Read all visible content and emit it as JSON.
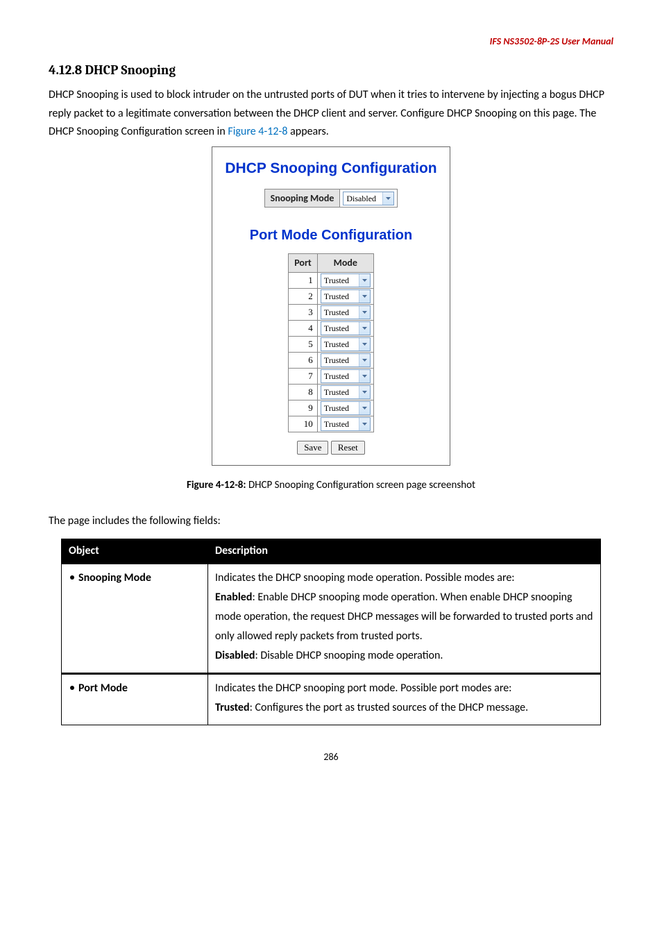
{
  "header": {
    "product_line": "IFS NS3502-8P-2S  User  Manual"
  },
  "section": {
    "heading": "4.12.8 DHCP Snooping",
    "paragraph_a": "DHCP Snooping is used to block intruder on the untrusted ports of DUT when it tries to intervene by injecting a bogus DHCP reply packet to a legitimate conversation between the DHCP client and server. Configure DHCP Snooping on this page. The DHCP Snooping Configuration screen in ",
    "figure_link": "Figure 4-12-8",
    "paragraph_b": " appears."
  },
  "panel": {
    "title": "DHCP Snooping Configuration",
    "snooping_mode_header": "Snooping Mode",
    "snooping_mode_value": "Disabled",
    "subtitle": "Port Mode Configuration",
    "port_header": "Port",
    "mode_header": "Mode",
    "rows": [
      {
        "port": "1",
        "mode": "Trusted"
      },
      {
        "port": "2",
        "mode": "Trusted"
      },
      {
        "port": "3",
        "mode": "Trusted"
      },
      {
        "port": "4",
        "mode": "Trusted"
      },
      {
        "port": "5",
        "mode": "Trusted"
      },
      {
        "port": "6",
        "mode": "Trusted"
      },
      {
        "port": "7",
        "mode": "Trusted"
      },
      {
        "port": "8",
        "mode": "Trusted"
      },
      {
        "port": "9",
        "mode": "Trusted"
      },
      {
        "port": "10",
        "mode": "Trusted"
      }
    ],
    "save_btn": "Save",
    "reset_btn": "Reset"
  },
  "caption": {
    "strong": "Figure 4-12-8:",
    "rest": " DHCP Snooping Configuration screen page screenshot"
  },
  "fields_intro": "The page includes the following fields:",
  "table": {
    "object_header": "Object",
    "description_header": "Description",
    "rows": [
      {
        "object": "Snooping Mode",
        "lines": [
          {
            "text": "Indicates the DHCP snooping mode operation. Possible modes are:"
          },
          {
            "bold": "Enabled",
            "text": ": Enable DHCP snooping mode operation. When enable DHCP snooping mode operation, the request DHCP messages will be forwarded to trusted ports and only allowed reply packets from trusted ports."
          },
          {
            "bold": "Disabled",
            "text": ": Disable DHCP snooping mode operation."
          }
        ]
      },
      {
        "object": "Port Mode",
        "lines": [
          {
            "text": "Indicates the DHCP snooping port mode. Possible port modes are:"
          },
          {
            "bold": "Trusted",
            "text": ": Configures the port as trusted sources of the DHCP message."
          }
        ]
      }
    ]
  },
  "page_number": "286"
}
